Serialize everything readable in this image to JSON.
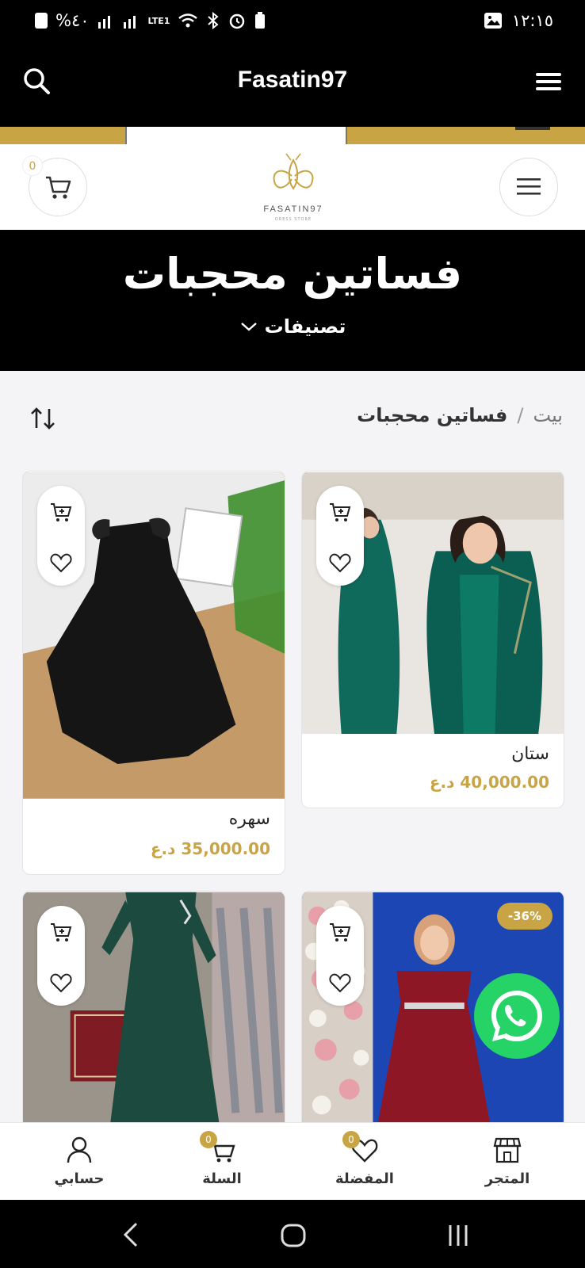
{
  "status_bar": {
    "left_text": "%٤٠",
    "lte_label": "LTE1",
    "time": "١٢:١٥"
  },
  "app_bar": {
    "title": "Fasatin97"
  },
  "site_header": {
    "cart_count": "0",
    "logo_brand": "FASATIN97",
    "logo_sub": "DRESS STORE"
  },
  "hero": {
    "title": "فساتين محجبات",
    "categories_label": "تصنيفات"
  },
  "breadcrumb": {
    "home": "بيت",
    "separator": "/",
    "current": "فساتين محجبات"
  },
  "products": [
    {
      "name": "ستان",
      "price": "40,000.00 د.ع",
      "sale_badge": ""
    },
    {
      "name": "سهره",
      "price": "35,000.00 د.ع",
      "sale_badge": ""
    },
    {
      "name": "",
      "price": "",
      "sale_badge": "-36%"
    },
    {
      "name": "",
      "price": "",
      "sale_badge": ""
    }
  ],
  "bottom_nav": {
    "items": [
      {
        "label": "المتجر",
        "icon": "store-icon",
        "badge": ""
      },
      {
        "label": "المفضلة",
        "icon": "heart-icon",
        "badge": "0"
      },
      {
        "label": "السلة",
        "icon": "cart-icon",
        "badge": "0"
      },
      {
        "label": "حسابي",
        "icon": "user-icon",
        "badge": ""
      }
    ]
  },
  "colors": {
    "accent_gold": "#c9a445",
    "bar_black": "#000000",
    "whatsapp_green": "#25d366"
  }
}
